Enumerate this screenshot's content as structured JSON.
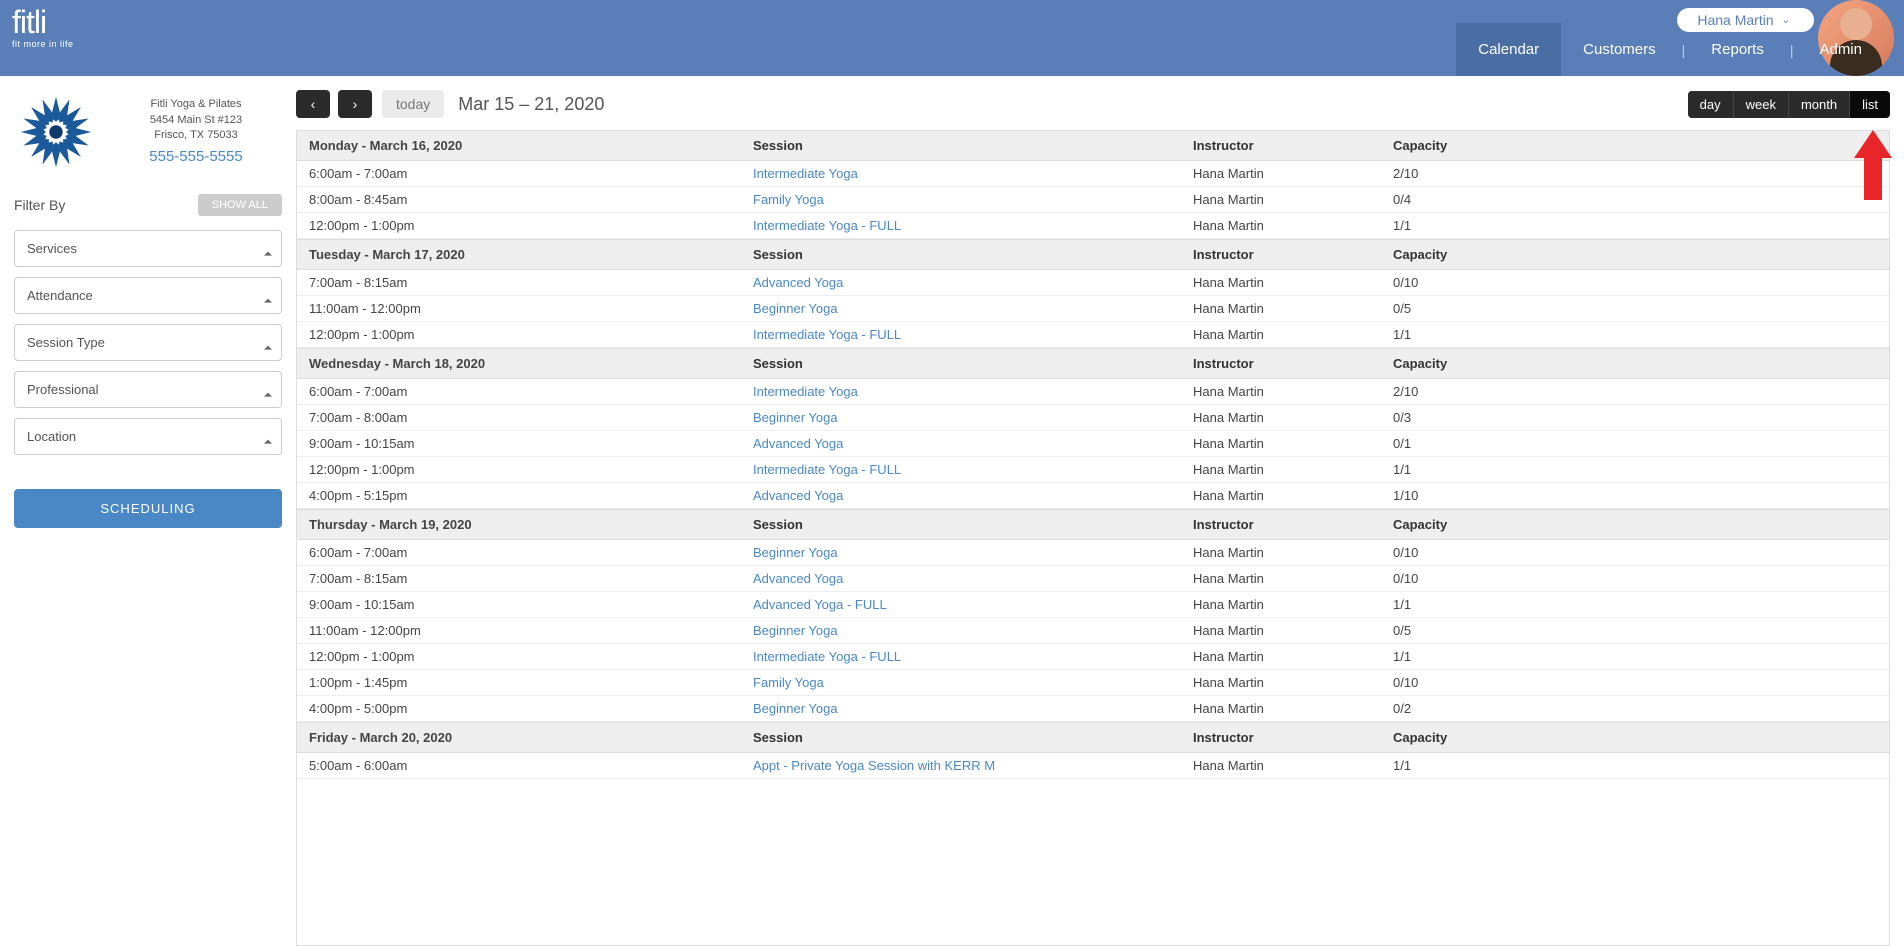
{
  "brand": {
    "name": "fitli",
    "tagline": "fit more in life"
  },
  "user": {
    "name": "Hana Martin"
  },
  "nav": {
    "calendar": "Calendar",
    "customers": "Customers",
    "reports": "Reports",
    "admin": "Admin"
  },
  "business": {
    "name": "Fitli Yoga & Pilates",
    "address1": "5454 Main St #123",
    "address2": "Frisco, TX 75033",
    "phone": "555-555-5555"
  },
  "filter": {
    "title": "Filter By",
    "show_all": "SHOW ALL",
    "services": "Services",
    "attendance": "Attendance",
    "session_type": "Session Type",
    "professional": "Professional",
    "location": "Location"
  },
  "scheduling_btn": "SCHEDULING",
  "toolbar": {
    "today": "today",
    "range": "Mar 15 – 21, 2020",
    "views": {
      "day": "day",
      "week": "week",
      "month": "month",
      "list": "list"
    }
  },
  "headers": {
    "session": "Session",
    "instructor": "Instructor",
    "capacity": "Capacity"
  },
  "days": [
    {
      "label": "Monday - March 16, 2020",
      "rows": [
        {
          "time": "6:00am - 7:00am",
          "session": "Intermediate Yoga",
          "instructor": "Hana Martin",
          "capacity": "2/10"
        },
        {
          "time": "8:00am - 8:45am",
          "session": "Family Yoga",
          "instructor": "Hana Martin",
          "capacity": "0/4"
        },
        {
          "time": "12:00pm - 1:00pm",
          "session": "Intermediate Yoga - FULL",
          "instructor": "Hana Martin",
          "capacity": "1/1"
        }
      ]
    },
    {
      "label": "Tuesday - March 17, 2020",
      "rows": [
        {
          "time": "7:00am - 8:15am",
          "session": "Advanced Yoga",
          "instructor": "Hana Martin",
          "capacity": "0/10"
        },
        {
          "time": "11:00am - 12:00pm",
          "session": "Beginner Yoga",
          "instructor": "Hana Martin",
          "capacity": "0/5"
        },
        {
          "time": "12:00pm - 1:00pm",
          "session": "Intermediate Yoga - FULL",
          "instructor": "Hana Martin",
          "capacity": "1/1"
        }
      ]
    },
    {
      "label": "Wednesday - March 18, 2020",
      "rows": [
        {
          "time": "6:00am - 7:00am",
          "session": "Intermediate Yoga",
          "instructor": "Hana Martin",
          "capacity": "2/10"
        },
        {
          "time": "7:00am - 8:00am",
          "session": "Beginner Yoga",
          "instructor": "Hana Martin",
          "capacity": "0/3"
        },
        {
          "time": "9:00am - 10:15am",
          "session": "Advanced Yoga",
          "instructor": "Hana Martin",
          "capacity": "0/1"
        },
        {
          "time": "12:00pm - 1:00pm",
          "session": "Intermediate Yoga - FULL",
          "instructor": "Hana Martin",
          "capacity": "1/1"
        },
        {
          "time": "4:00pm - 5:15pm",
          "session": "Advanced Yoga",
          "instructor": "Hana Martin",
          "capacity": "1/10"
        }
      ]
    },
    {
      "label": "Thursday - March 19, 2020",
      "rows": [
        {
          "time": "6:00am - 7:00am",
          "session": "Beginner Yoga",
          "instructor": "Hana Martin",
          "capacity": "0/10"
        },
        {
          "time": "7:00am - 8:15am",
          "session": "Advanced Yoga",
          "instructor": "Hana Martin",
          "capacity": "0/10"
        },
        {
          "time": "9:00am - 10:15am",
          "session": "Advanced Yoga - FULL",
          "instructor": "Hana Martin",
          "capacity": "1/1"
        },
        {
          "time": "11:00am - 12:00pm",
          "session": "Beginner Yoga",
          "instructor": "Hana Martin",
          "capacity": "0/5"
        },
        {
          "time": "12:00pm - 1:00pm",
          "session": "Intermediate Yoga - FULL",
          "instructor": "Hana Martin",
          "capacity": "1/1"
        },
        {
          "time": "1:00pm - 1:45pm",
          "session": "Family Yoga",
          "instructor": "Hana Martin",
          "capacity": "0/10"
        },
        {
          "time": "4:00pm - 5:00pm",
          "session": "Beginner Yoga",
          "instructor": "Hana Martin",
          "capacity": "0/2"
        }
      ]
    },
    {
      "label": "Friday - March 20, 2020",
      "rows": [
        {
          "time": "5:00am - 6:00am",
          "session": "Appt - Private Yoga Session with KERR M",
          "instructor": "Hana Martin",
          "capacity": "1/1"
        }
      ]
    }
  ]
}
